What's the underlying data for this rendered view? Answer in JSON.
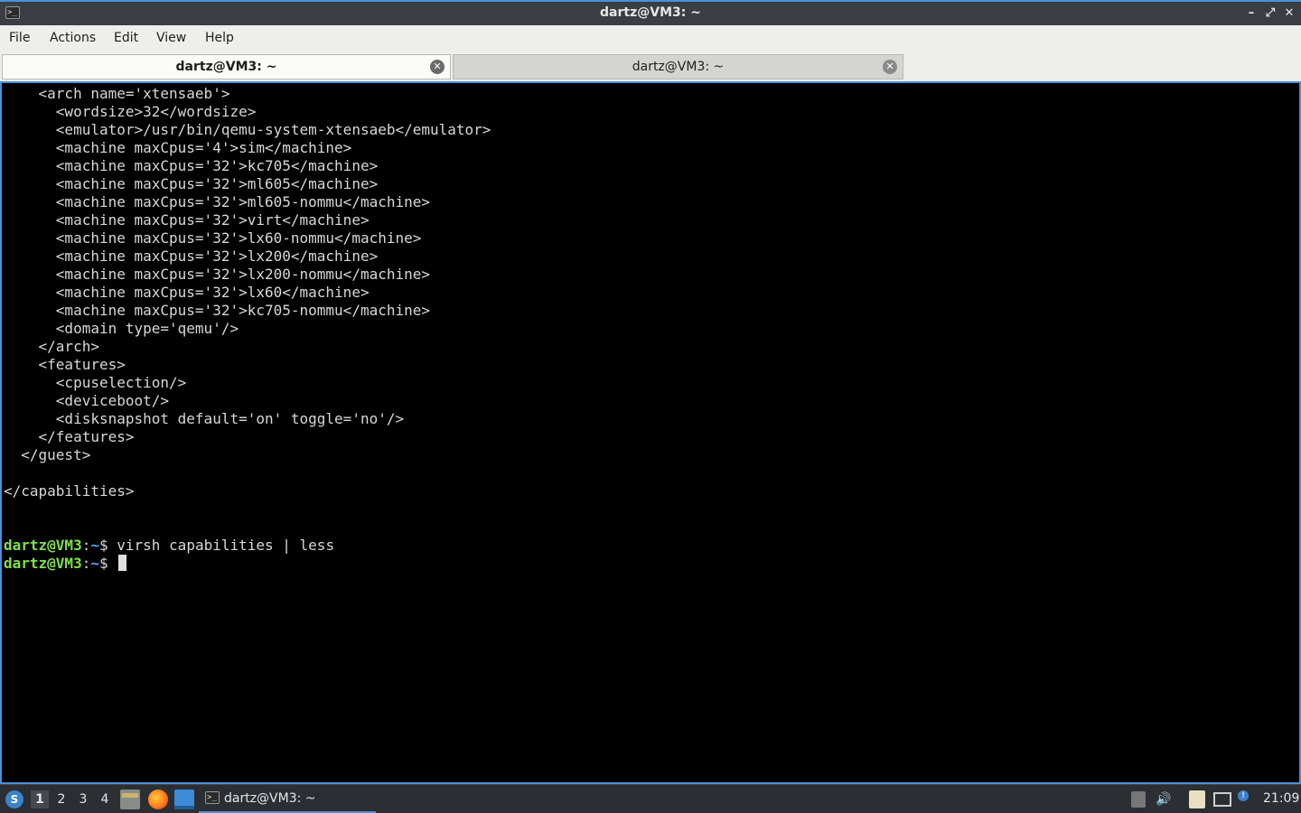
{
  "window": {
    "title": "dartz@VM3: ~",
    "app_icon": ">_",
    "controls": {
      "minimize": "–",
      "maximize": "⤢",
      "close": "✕"
    }
  },
  "menu": [
    "File",
    "Actions",
    "Edit",
    "View",
    "Help"
  ],
  "tabs": [
    {
      "label": "dartz@VM3: ~",
      "active": true,
      "close_icon": "✕"
    },
    {
      "label": "dartz@VM3: ~",
      "active": false,
      "close_icon": "✕"
    }
  ],
  "terminal": {
    "lines": [
      "    <arch name='xtensaeb'>",
      "      <wordsize>32</wordsize>",
      "      <emulator>/usr/bin/qemu-system-xtensaeb</emulator>",
      "      <machine maxCpus='4'>sim</machine>",
      "      <machine maxCpus='32'>kc705</machine>",
      "      <machine maxCpus='32'>ml605</machine>",
      "      <machine maxCpus='32'>ml605-nommu</machine>",
      "      <machine maxCpus='32'>virt</machine>",
      "      <machine maxCpus='32'>lx60-nommu</machine>",
      "      <machine maxCpus='32'>lx200</machine>",
      "      <machine maxCpus='32'>lx200-nommu</machine>",
      "      <machine maxCpus='32'>lx60</machine>",
      "      <machine maxCpus='32'>kc705-nommu</machine>",
      "      <domain type='qemu'/>",
      "    </arch>",
      "    <features>",
      "      <cpuselection/>",
      "      <deviceboot/>",
      "      <disksnapshot default='on' toggle='no'/>",
      "    </features>",
      "  </guest>",
      "",
      "</capabilities>"
    ],
    "prompts": [
      {
        "user": "dartz@VM3",
        "sep": ":",
        "path": "~",
        "symbol": "$ ",
        "command": "virsh capabilities | less"
      },
      {
        "user": "dartz@VM3",
        "sep": ":",
        "path": "~",
        "symbol": "$ ",
        "command": ""
      }
    ],
    "colors": {
      "background": "#000000",
      "text": "#d8d8d8",
      "user": "#7fe04a",
      "path": "#5aa0ff"
    }
  },
  "taskbar": {
    "start_icon": "start-menu-icon",
    "workspaces": [
      "1",
      "2",
      "3",
      "4"
    ],
    "active_workspace": "1",
    "launchers": [
      "file-manager-icon",
      "firefox-icon",
      "show-desktop-icon"
    ],
    "task": {
      "label": "dartz@VM3: ~",
      "icon": ">_"
    },
    "tray": {
      "volume_glyph": "🔊",
      "badge": "!"
    },
    "clock": "21:09"
  }
}
